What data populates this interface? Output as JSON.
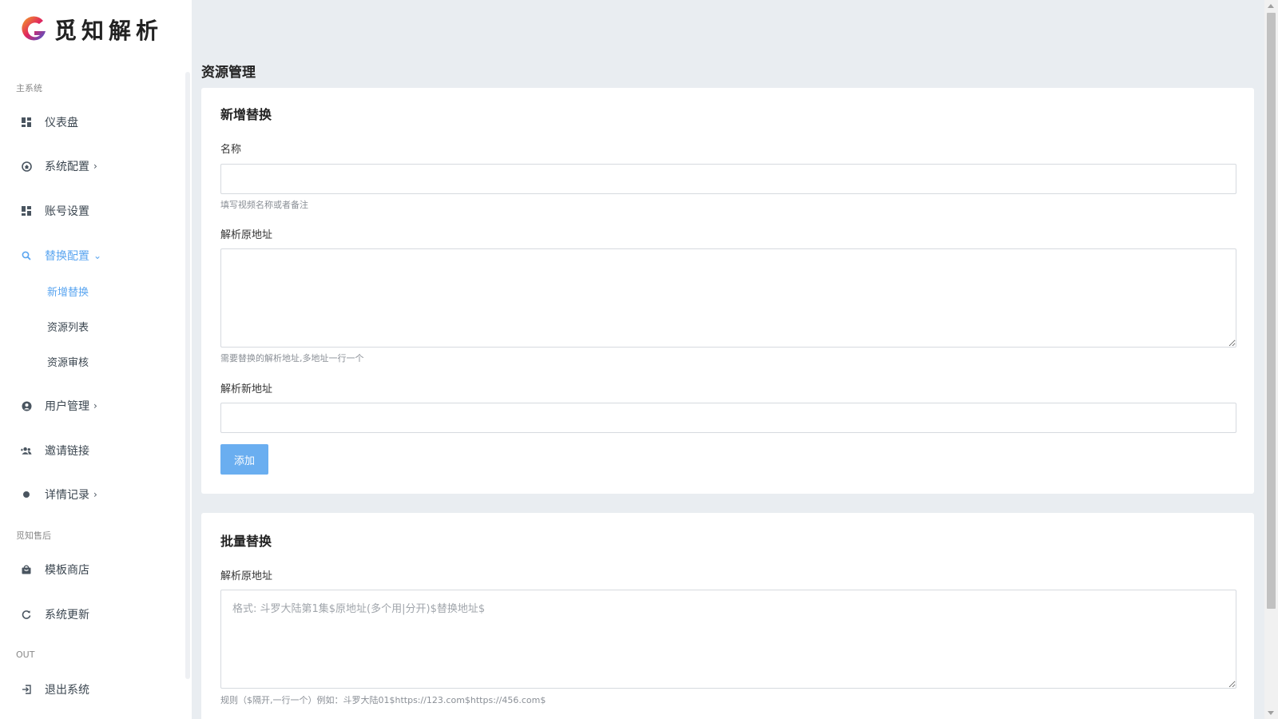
{
  "brand": {
    "name": "觅知解析"
  },
  "sidebar": {
    "sections": {
      "main": "主系统",
      "after_sale": "觅知售后",
      "out": "OUT"
    },
    "items": {
      "dashboard": "仪表盘",
      "system_config": "系统配置",
      "account": "账号设置",
      "replace_config": "替换配置",
      "user_manage": "用户管理",
      "invite": "邀请链接",
      "records": "详情记录",
      "template_store": "模板商店",
      "system_update": "系统更新",
      "logout": "退出系统"
    },
    "sub_items": {
      "add_replace": "新增替换",
      "resource_list": "资源列表",
      "resource_review": "资源审核"
    },
    "active_color": "#5aa5f0"
  },
  "main": {
    "page_title": "资源管理",
    "add_card": {
      "title": "新增替换",
      "name_label": "名称",
      "name_value": "",
      "name_help": "填写视频名称或者备注",
      "origin_label": "解析原地址",
      "origin_value": "",
      "origin_help": "需要替换的解析地址,多地址一行一个",
      "new_label": "解析新地址",
      "new_value": "",
      "add_button": "添加"
    },
    "batch_card": {
      "title": "批量替换",
      "origin_label": "解析原地址",
      "origin_placeholder": "格式: 斗罗大陆第1集$原地址(多个用|分开)$替换地址$",
      "rule_help": "规则（$隔开,一行一个）例如：斗罗大陆01$https://123.com$https://456.com$"
    }
  },
  "colors": {
    "primary_button": "#6aaef0",
    "background": "#e9edf1"
  }
}
